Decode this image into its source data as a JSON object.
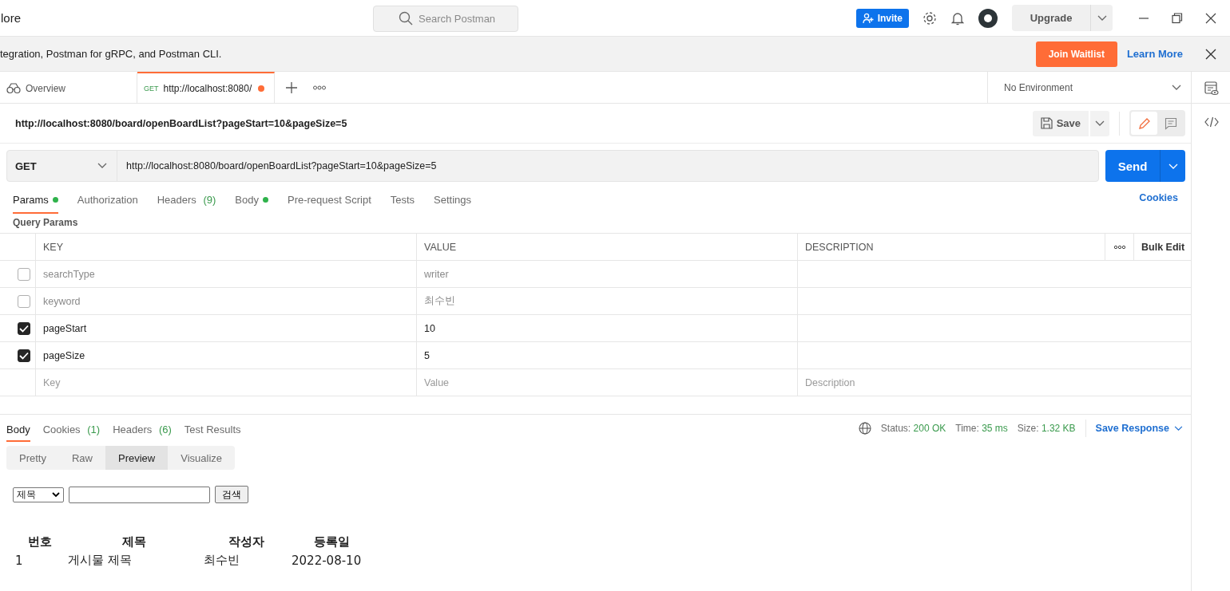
{
  "header": {
    "title_fragment": "lore",
    "search": {
      "placeholder": "Search Postman"
    },
    "invite_button": "Invite",
    "upgrade_button": "Upgrade"
  },
  "banner": {
    "text": "tegration, Postman for gRPC, and Postman CLI.",
    "primary_button": "Join Waitlist",
    "link": "Learn More"
  },
  "tabs": [
    {
      "kind": "overview",
      "label": "Overview",
      "selected": false
    },
    {
      "kind": "request",
      "method": "GET",
      "label": "http://localhost:8080/",
      "selected": true,
      "unsaved": true
    }
  ],
  "environment": {
    "value": "No Environment"
  },
  "request": {
    "title": "http://localhost:8080/board/openBoardList?pageStart=10&pageSize=5",
    "save_button": "Save",
    "method": "GET",
    "url": "http://localhost:8080/board/openBoardList?pageStart=10&pageSize=5",
    "send_button": "Send",
    "mode_toggle": [
      {
        "kind": "edit",
        "selected": true
      },
      {
        "kind": "comments",
        "selected": false
      }
    ]
  },
  "request_tabs": [
    {
      "label": "Params",
      "dot": true,
      "selected": true
    },
    {
      "label": "Authorization",
      "dot": false,
      "selected": false
    },
    {
      "label": "Headers",
      "count": "(9)",
      "dot": false,
      "selected": false
    },
    {
      "label": "Body",
      "dot": true,
      "selected": false
    },
    {
      "label": "Pre-request Script",
      "dot": false,
      "selected": false
    },
    {
      "label": "Tests",
      "dot": false,
      "selected": false
    },
    {
      "label": "Settings",
      "dot": false,
      "selected": false
    }
  ],
  "cookies_link": "Cookies",
  "params": {
    "title": "Query Params",
    "columns": [
      "KEY",
      "VALUE",
      "DESCRIPTION"
    ],
    "bulk_edit": "Bulk Edit",
    "rows": [
      {
        "checked": false,
        "key": "searchType",
        "value": "writer"
      },
      {
        "checked": false,
        "key": "keyword",
        "value": "최수빈"
      },
      {
        "checked": true,
        "key": "pageStart",
        "value": "10"
      },
      {
        "checked": true,
        "key": "pageSize",
        "value": "5"
      }
    ],
    "new_row": {
      "key_placeholder": "Key",
      "value_placeholder": "Value",
      "description_placeholder": "Description"
    }
  },
  "response": {
    "tabs": [
      {
        "label": "Body",
        "selected": true
      },
      {
        "label": "Cookies",
        "count": "(1)",
        "selected": false
      },
      {
        "label": "Headers",
        "count": "(6)",
        "selected": false
      },
      {
        "label": "Test Results",
        "selected": false
      }
    ],
    "stats": [
      {
        "label": "Status:",
        "value": "200 OK"
      },
      {
        "label": "Time:",
        "value": "35 ms"
      },
      {
        "label": "Size:",
        "value": "1.32 KB"
      }
    ],
    "save_response": "Save Response",
    "view_modes": [
      {
        "label": "Pretty",
        "selected": false
      },
      {
        "label": "Raw",
        "selected": false
      },
      {
        "label": "Preview",
        "selected": true
      },
      {
        "label": "Visualize",
        "selected": false
      }
    ],
    "preview": {
      "select": "제목",
      "search_button": "검색",
      "columns": [
        "번호",
        "제목",
        "작성자",
        "등록일"
      ],
      "rows": [
        [
          "1",
          "게시물 제목",
          "최수빈",
          "2022-08-10"
        ]
      ]
    }
  }
}
